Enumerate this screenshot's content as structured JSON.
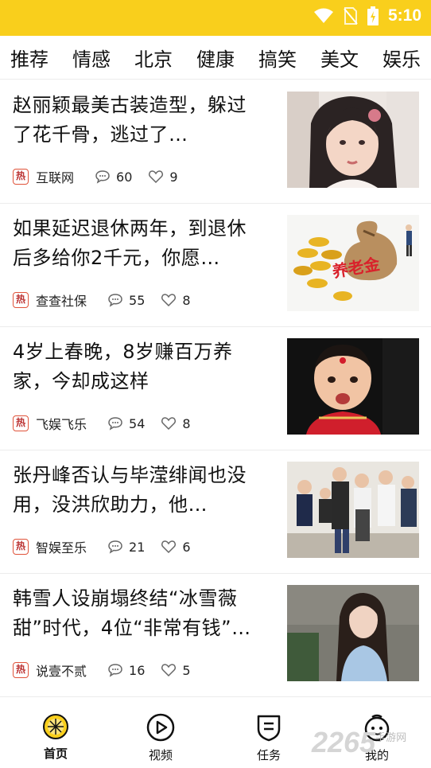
{
  "status": {
    "time": "5:10"
  },
  "tabs": [
    "推荐",
    "情感",
    "北京",
    "健康",
    "搞笑",
    "美文",
    "娱乐"
  ],
  "hot_badge": "热",
  "feed": [
    {
      "title": "赵丽颖最美古装造型，躲过了花千骨，逃过了…",
      "source": "互联网",
      "comments": "60",
      "likes": "9"
    },
    {
      "title": "如果延迟退休两年，到退休后多给你2千元，你愿…",
      "source": "查查社保",
      "comments": "55",
      "likes": "8",
      "image_text": "养老金"
    },
    {
      "title": "4岁上春晚，8岁赚百万养家，今却成这样",
      "source": "飞娱飞乐",
      "comments": "54",
      "likes": "8"
    },
    {
      "title": "张丹峰否认与毕滢绯闻也没用，没洪欣助力，他…",
      "source": "智娱至乐",
      "comments": "21",
      "likes": "6"
    },
    {
      "title": "韩雪人设崩塌终结“冰雪薇甜”时代，4位“非常有钱”…",
      "source": "说壹不贰",
      "comments": "16",
      "likes": "5"
    }
  ],
  "bottom_nav": [
    {
      "label": "首页",
      "icon": "home-lemon-icon",
      "active": true
    },
    {
      "label": "视频",
      "icon": "video-play-icon",
      "active": false
    },
    {
      "label": "任务",
      "icon": "task-shield-icon",
      "active": false
    },
    {
      "label": "我的",
      "icon": "profile-face-icon",
      "active": false
    }
  ],
  "watermark": {
    "text": "2265",
    "sub": "手游网"
  }
}
